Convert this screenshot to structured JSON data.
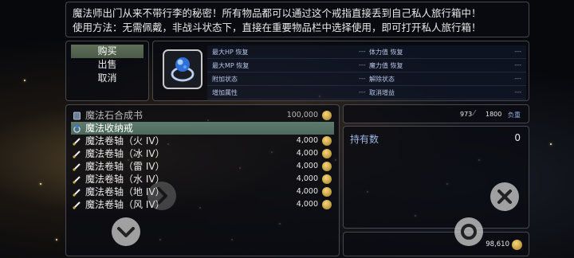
{
  "description": {
    "line1": "魔法师出门从来不带行李的秘密！所有物品都可以通过这个戒指直接丢到自己私人旅行箱中！",
    "line2": "使用方法：无需佩戴，非战斗状态下，直接在重要物品栏中选择使用，即可打开私人旅行箱！"
  },
  "menu": {
    "items": [
      {
        "label": "购买",
        "selected": true
      },
      {
        "label": "出售",
        "selected": false
      },
      {
        "label": "取消",
        "selected": false
      }
    ]
  },
  "item_info": {
    "icon": "ring-icon",
    "stats": [
      {
        "l": "最大HP 恢复",
        "lv": "---",
        "r": "体力值 恢复",
        "rv": "---"
      },
      {
        "l": "最大MP 恢复",
        "lv": "---",
        "r": "魔力值 恢复",
        "rv": "---"
      },
      {
        "l": "附加状态",
        "lv": "---",
        "r": "解除状态",
        "rv": "---"
      },
      {
        "l": "增加属性",
        "lv": "---",
        "r": "取消增益",
        "rv": "---"
      }
    ]
  },
  "shop_list": [
    {
      "name": "魔法石合成书",
      "price": "100,000",
      "icon": "book-icon",
      "selected": false,
      "gray": true
    },
    {
      "name": "魔法收纳戒",
      "price": "",
      "icon": "ring-icon",
      "selected": true,
      "gray": false
    },
    {
      "name": "魔法卷轴（火 IV）",
      "price": "4,000",
      "icon": "scroll-icon",
      "selected": false,
      "gray": false
    },
    {
      "name": "魔法卷轴（冰 IV）",
      "price": "4,000",
      "icon": "scroll-icon",
      "selected": false,
      "gray": false
    },
    {
      "name": "魔法卷轴（雷 IV）",
      "price": "4,000",
      "icon": "scroll-icon",
      "selected": false,
      "gray": false
    },
    {
      "name": "魔法卷轴（水 IV）",
      "price": "4,000",
      "icon": "scroll-icon",
      "selected": false,
      "gray": false
    },
    {
      "name": "魔法卷轴（地 IV）",
      "price": "4,000",
      "icon": "scroll-icon",
      "selected": false,
      "gray": false
    },
    {
      "name": "魔法卷轴（风 IV）",
      "price": "4,000",
      "icon": "scroll-icon",
      "selected": false,
      "gray": false
    }
  ],
  "weight": {
    "current": "973",
    "max": "1800",
    "label": "负重"
  },
  "owned": {
    "label": "持有数",
    "value": "0"
  },
  "gold": {
    "amount": "98,610"
  },
  "colors": {
    "accent": "#5f7a6e",
    "stat_label": "#b7c4e6",
    "coin": "#d9a93a"
  }
}
